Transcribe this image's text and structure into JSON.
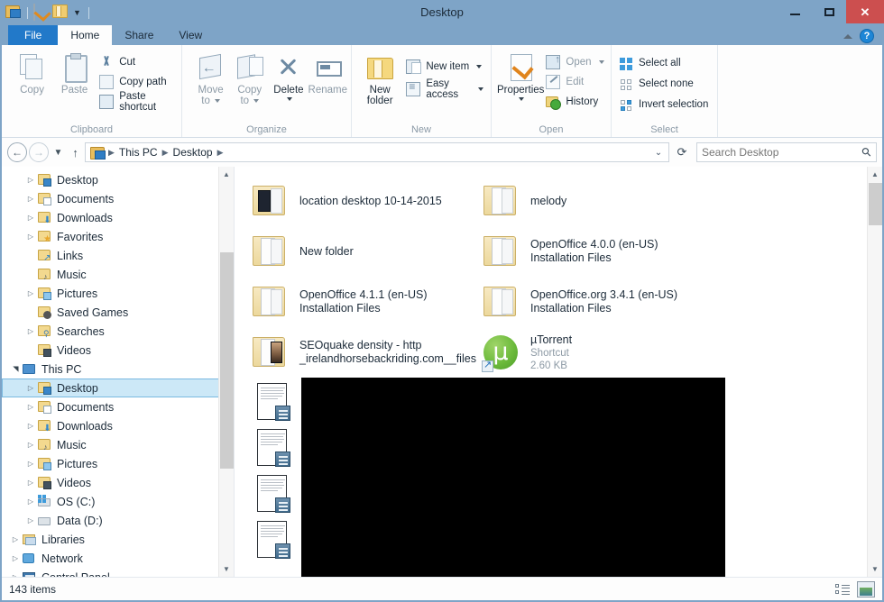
{
  "window": {
    "title": "Desktop",
    "minimize_label": "Minimize",
    "maximize_label": "Maximize",
    "close_label": "Close"
  },
  "quick_access": {
    "explorer_label": "File Explorer",
    "properties_label": "Properties",
    "new_folder_label": "New folder",
    "customize_label": "Customize Quick Access Toolbar"
  },
  "tabs": [
    {
      "label": "File",
      "state": "file"
    },
    {
      "label": "Home",
      "state": "active"
    },
    {
      "label": "Share",
      "state": "normal"
    },
    {
      "label": "View",
      "state": "normal"
    }
  ],
  "ribbon": {
    "minimize_ribbon_label": "Minimize the Ribbon",
    "help_label": "?",
    "groups": [
      {
        "title": "Clipboard",
        "big": [
          {
            "label": "Copy",
            "icon": "copy-icon",
            "enabled": false
          },
          {
            "label": "Paste",
            "icon": "paste-icon",
            "enabled": false
          }
        ],
        "small": [
          {
            "label": "Cut",
            "icon": "scissors-icon",
            "enabled": true
          },
          {
            "label": "Copy path",
            "icon": "copy-path-icon",
            "enabled": true
          },
          {
            "label": "Paste shortcut",
            "icon": "paste-shortcut-icon",
            "enabled": true
          }
        ]
      },
      {
        "title": "Organize",
        "big": [
          {
            "label": "Move\nto",
            "label1": "Move",
            "label2": "to",
            "icon": "move-to-icon",
            "enabled": false,
            "dropdown": true
          },
          {
            "label": "Copy\nto",
            "label1": "Copy",
            "label2": "to",
            "icon": "copy-to-icon",
            "enabled": false,
            "dropdown": true
          },
          {
            "label": "Delete",
            "icon": "delete-icon",
            "enabled": true,
            "dropdown": true
          },
          {
            "label": "Rename",
            "icon": "rename-icon",
            "enabled": false
          }
        ]
      },
      {
        "title": "New",
        "big": [
          {
            "label1": "New",
            "label2": "folder",
            "icon": "new-folder-icon",
            "enabled": true
          }
        ],
        "small": [
          {
            "label": "New item",
            "icon": "new-item-icon",
            "enabled": true,
            "dropdown": true
          },
          {
            "label": "Easy access",
            "icon": "easy-access-icon",
            "enabled": true,
            "dropdown": true
          }
        ]
      },
      {
        "title": "Open",
        "big": [
          {
            "label": "Properties",
            "icon": "properties-icon",
            "enabled": true,
            "dropdown": true
          }
        ],
        "small": [
          {
            "label": "Open",
            "icon": "open-icon",
            "enabled": false,
            "dropdown": true
          },
          {
            "label": "Edit",
            "icon": "edit-icon",
            "enabled": false
          },
          {
            "label": "History",
            "icon": "history-icon",
            "enabled": true
          }
        ]
      },
      {
        "title": "Select",
        "small": [
          {
            "label": "Select all",
            "icon": "select-all-icon",
            "enabled": true
          },
          {
            "label": "Select none",
            "icon": "select-none-icon",
            "enabled": true
          },
          {
            "label": "Invert selection",
            "icon": "invert-selection-icon",
            "enabled": true
          }
        ]
      }
    ]
  },
  "address_bar": {
    "back_label": "Back",
    "forward_label": "Forward",
    "recent_label": "Recent locations",
    "up_label": "Up one level",
    "breadcrumbs": [
      "This PC",
      "Desktop"
    ],
    "dropdown_label": "Previous locations",
    "refresh_label": "Refresh",
    "search_placeholder": "Search Desktop",
    "search_value": ""
  },
  "nav_pane": {
    "items": [
      {
        "label": "Desktop",
        "indent": 2,
        "twisty": "collapsed",
        "icon": "desktop-folder-icon",
        "selected": false
      },
      {
        "label": "Documents",
        "indent": 2,
        "twisty": "collapsed",
        "icon": "documents-folder-icon",
        "selected": false
      },
      {
        "label": "Downloads",
        "indent": 2,
        "twisty": "collapsed",
        "icon": "downloads-folder-icon",
        "selected": false
      },
      {
        "label": "Favorites",
        "indent": 2,
        "twisty": "collapsed",
        "icon": "favorites-folder-icon",
        "selected": false
      },
      {
        "label": "Links",
        "indent": 2,
        "twisty": "none",
        "icon": "links-folder-icon",
        "selected": false
      },
      {
        "label": "Music",
        "indent": 2,
        "twisty": "none",
        "icon": "music-folder-icon",
        "selected": false
      },
      {
        "label": "Pictures",
        "indent": 2,
        "twisty": "collapsed",
        "icon": "pictures-folder-icon",
        "selected": false
      },
      {
        "label": "Saved Games",
        "indent": 2,
        "twisty": "none",
        "icon": "saved-games-icon",
        "selected": false
      },
      {
        "label": "Searches",
        "indent": 2,
        "twisty": "collapsed",
        "icon": "searches-folder-icon",
        "selected": false
      },
      {
        "label": "Videos",
        "indent": 2,
        "twisty": "none",
        "icon": "videos-folder-icon",
        "selected": false
      },
      {
        "label": "This PC",
        "indent": 1,
        "twisty": "expanded",
        "icon": "this-pc-icon",
        "selected": false
      },
      {
        "label": "Desktop",
        "indent": 2,
        "twisty": "collapsed",
        "icon": "desktop-folder-icon",
        "selected": true
      },
      {
        "label": "Documents",
        "indent": 2,
        "twisty": "collapsed",
        "icon": "documents-folder-icon",
        "selected": false
      },
      {
        "label": "Downloads",
        "indent": 2,
        "twisty": "collapsed",
        "icon": "downloads-folder-icon",
        "selected": false
      },
      {
        "label": "Music",
        "indent": 2,
        "twisty": "collapsed",
        "icon": "music-folder-icon",
        "selected": false
      },
      {
        "label": "Pictures",
        "indent": 2,
        "twisty": "collapsed",
        "icon": "pictures-folder-icon",
        "selected": false
      },
      {
        "label": "Videos",
        "indent": 2,
        "twisty": "collapsed",
        "icon": "videos-folder-icon",
        "selected": false
      },
      {
        "label": "OS (C:)",
        "indent": 2,
        "twisty": "collapsed",
        "icon": "os-drive-icon",
        "selected": false
      },
      {
        "label": "Data (D:)",
        "indent": 2,
        "twisty": "collapsed",
        "icon": "data-drive-icon",
        "selected": false
      },
      {
        "label": "Libraries",
        "indent": 1,
        "twisty": "collapsed",
        "icon": "libraries-icon",
        "selected": false
      },
      {
        "label": "Network",
        "indent": 1,
        "twisty": "collapsed",
        "icon": "network-icon",
        "selected": false
      },
      {
        "label": "Control Panel",
        "indent": 1,
        "twisty": "collapsed",
        "icon": "control-panel-icon",
        "selected": false
      }
    ],
    "scroll_up_label": "Scroll up",
    "scroll_down_label": "Scroll down"
  },
  "file_list": {
    "items": [
      {
        "name": "location desktop 10-14-2015",
        "name2": "",
        "sub": "",
        "icon": "folder-thumb-icon"
      },
      {
        "name": "melody",
        "name2": "",
        "sub": "",
        "icon": "folder-icon"
      },
      {
        "name": "New folder",
        "name2": "",
        "sub": "",
        "icon": "folder-icon"
      },
      {
        "name": "OpenOffice 4.0.0 (en-US)",
        "name2": "Installation Files",
        "sub": "",
        "icon": "folder-icon"
      },
      {
        "name": "OpenOffice 4.1.1 (en-US)",
        "name2": "Installation Files",
        "sub": "",
        "icon": "folder-icon"
      },
      {
        "name": "OpenOffice.org 3.4.1 (en-US)",
        "name2": "Installation Files",
        "sub": "",
        "icon": "folder-icon"
      },
      {
        "name": "SEOquake density - http",
        "name2": "_irelandhorsebackriding.com__files",
        "sub": "",
        "icon": "folder-photo-icon"
      },
      {
        "name": "µTorrent",
        "name2": "Shortcut",
        "sub": "2.60 KB",
        "icon": "utorrent-shortcut-icon"
      }
    ],
    "hidden_rows": [
      {
        "icon": "document-icon"
      },
      {
        "icon": "document-icon"
      },
      {
        "icon": "document-icon"
      },
      {
        "icon": "document-icon"
      }
    ],
    "scroll_up_label": "Scroll up",
    "scroll_down_label": "Scroll down"
  },
  "status_bar": {
    "item_count": "143 items",
    "details_view_label": "Details view",
    "large_icons_view_label": "Large icons view"
  },
  "colors": {
    "window_frame": "#7ea4c7",
    "file_tab": "#2279c9",
    "close_button": "#cc4f4f",
    "selection": "#cce8f7",
    "selection_border": "#7ab9e0",
    "accent_blue": "#3d9bdc",
    "folder_yellow": "#f3d98f",
    "utorrent_green": "#6dbb3c"
  }
}
